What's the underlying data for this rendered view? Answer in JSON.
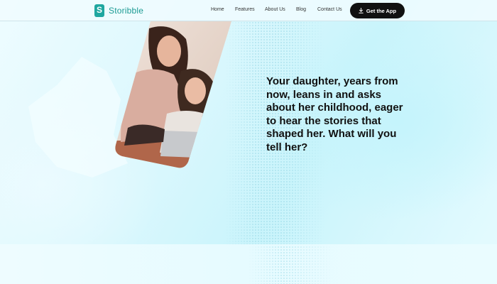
{
  "brand": {
    "name": "Storibble",
    "logo_letter": "S"
  },
  "nav": {
    "items": [
      {
        "id": "home",
        "label": "Home"
      },
      {
        "id": "features",
        "label": "Features"
      },
      {
        "id": "about",
        "label": "About Us"
      },
      {
        "id": "blog",
        "label": "Blog"
      },
      {
        "id": "contact",
        "label": "Contact Us"
      }
    ],
    "cta_label": "Get the App"
  },
  "hero": {
    "headline": "Your daughter, years from now, leans in and asks about her childhood, eager to hear the stories that shaped her. What will you tell her?",
    "image_alt": "mother and daughter looking at a laptop"
  },
  "colors": {
    "brand": "#1fa7a0",
    "cta_bg": "#111111",
    "text": "#111111"
  }
}
